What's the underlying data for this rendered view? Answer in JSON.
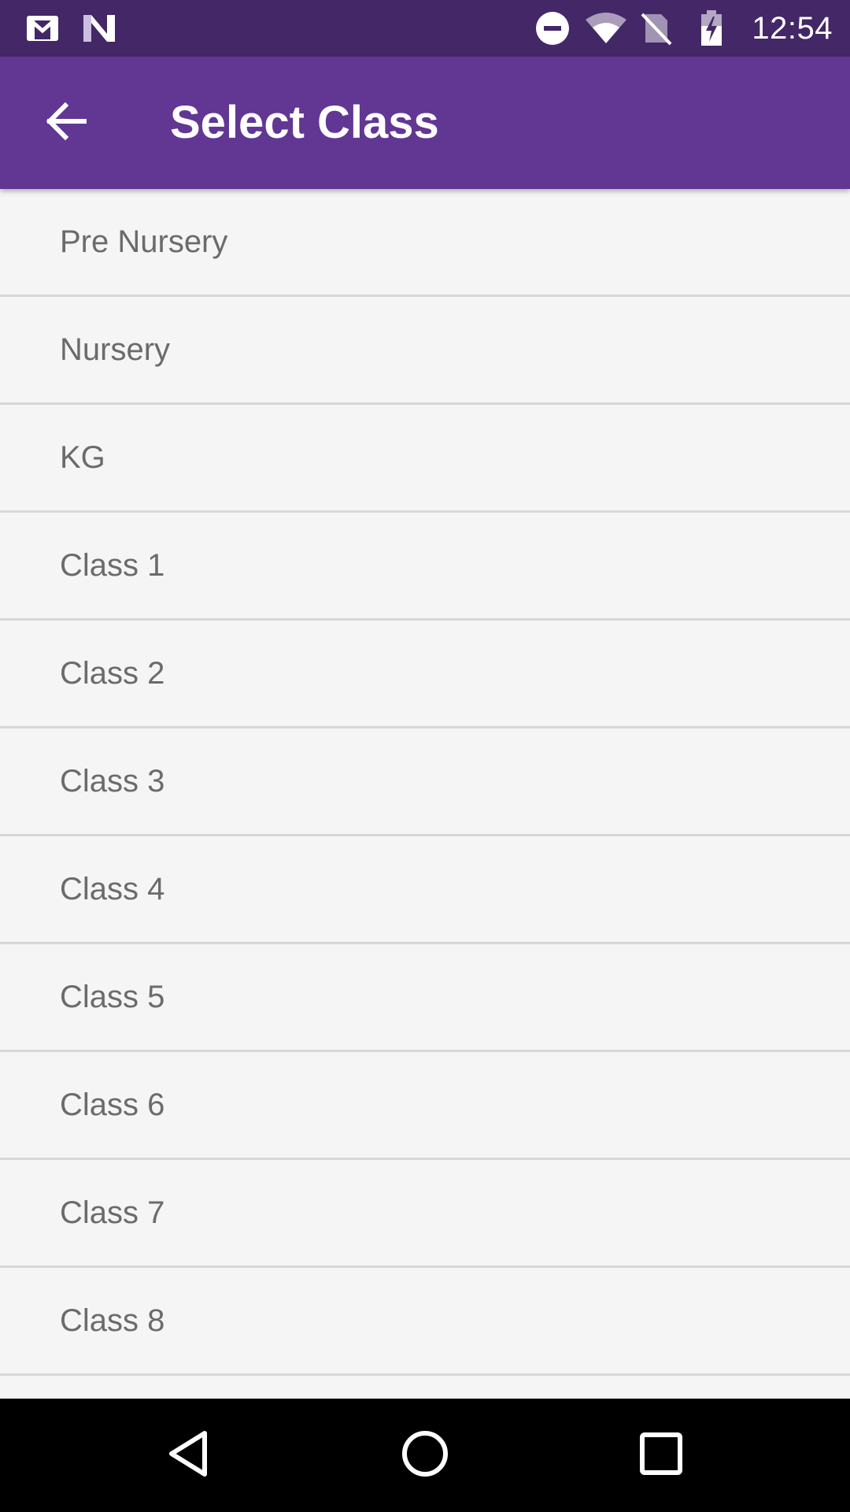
{
  "status_bar": {
    "time": "12:54",
    "icons": [
      "gmail-icon",
      "n-app-icon",
      "do-not-disturb-icon",
      "wifi-icon",
      "no-sim-icon",
      "battery-charging-icon"
    ]
  },
  "app_bar": {
    "back_icon": "arrow-back-icon",
    "title": "Select Class"
  },
  "classes": [
    "Pre Nursery",
    "Nursery",
    "KG",
    "Class 1",
    "Class 2",
    "Class 3",
    "Class 4",
    "Class 5",
    "Class 6",
    "Class 7",
    "Class 8"
  ],
  "nav_bar": {
    "icons": [
      "back-triangle-icon",
      "home-circle-icon",
      "recents-square-icon"
    ]
  },
  "colors": {
    "status_bar": "#432766",
    "app_bar": "#613793",
    "background": "#f5f5f5",
    "text": "#6b6b6b",
    "divider": "#d7d7d7"
  }
}
